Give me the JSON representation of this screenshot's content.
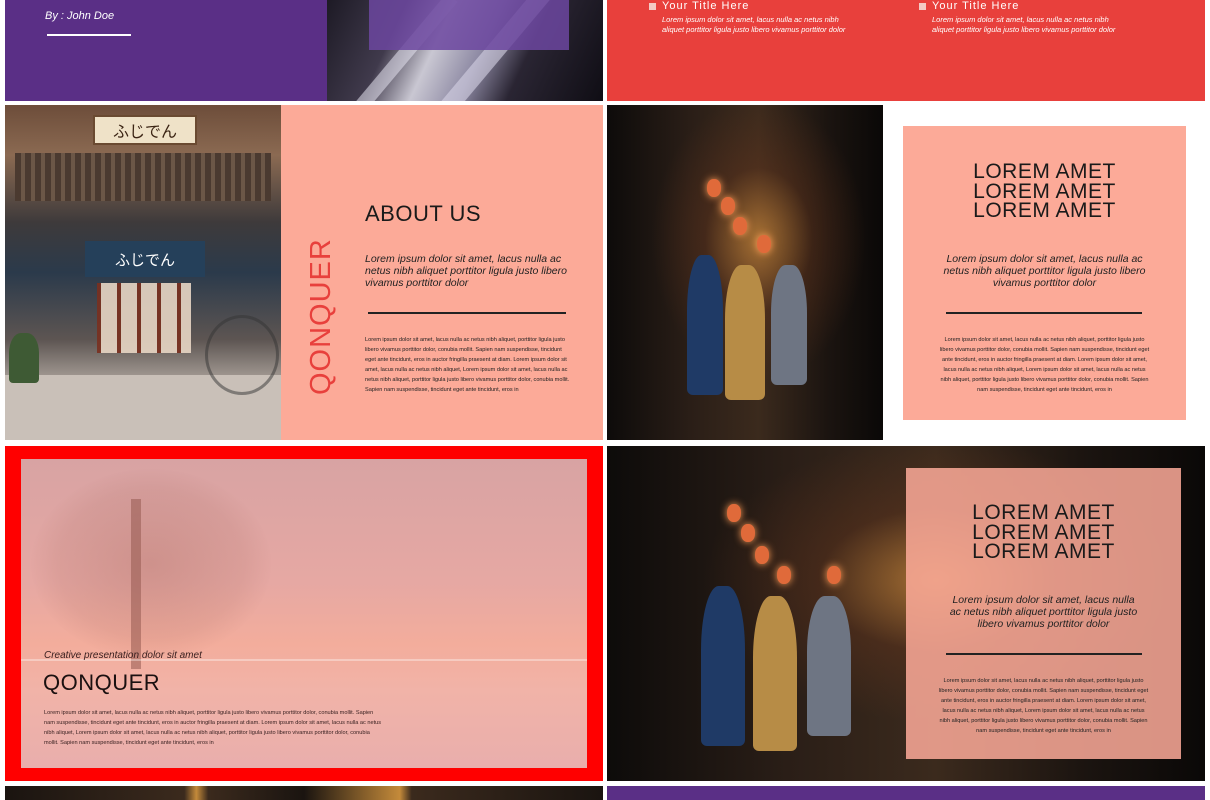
{
  "slides": {
    "top_left": {
      "byline": "By : John Doe"
    },
    "top_right": {
      "columns": [
        {
          "title": "Your Title Here",
          "description": "Lorem ipsum dolor sit amet, lacus nulla ac netus nibh aliquet porttitor ligula justo libero vivamus porttitor dolor"
        },
        {
          "title": "Your Title Here",
          "description": "Lorem ipsum dolor sit amet, lacus nulla ac netus nibh aliquet porttitor ligula justo libero vivamus porttitor dolor"
        }
      ]
    },
    "about": {
      "shop_sign": "ふじでん",
      "shop_curtain": "ふじでん",
      "brand": "QONQUER",
      "heading": "ABOUT US",
      "intro": "Lorem ipsum dolor sit amet, lacus nulla ac netus nibh aliquet porttitor ligula justo libero vivamus porttitor dolor",
      "body": "Lorem ipsum dolor sit amet, lacus nulla ac netus nibh aliquet, porttitor ligula justo libero vivamus porttitor dolor, conubia mollit. Sapien nam suspendisse, tincidunt eget ante tincidunt, eros in auctor fringilla praesent at diam. Lorem ipsum dolor sit amet, lacus nulla ac netus nibh aliquet, Lorem ipsum dolor sit amet, lacus nulla ac netus nibh aliquet, porttitor ligula justo libero vivamus porttitor dolor, conubia mollit. Sapien nam suspendisse, tincidunt eget ante tincidunt, eros in"
    },
    "lorem_card_1": {
      "lines": [
        "LOREM AMET",
        "LOREM AMET",
        "LOREM AMET"
      ],
      "lead": "Lorem ipsum dolor sit amet, lacus nulla ac netus nibh aliquet porttitor ligula justo libero vivamus porttitor dolor",
      "body": "Lorem ipsum dolor sit amet, lacus nulla ac netus nibh aliquet, porttitor ligula justo libero vivamus porttitor dolor, conubia mollit. Sapien nam suspendisse, tincidunt eget ante tincidunt, eros in auctor fringilla praesent at diam. Lorem ipsum dolor sit amet, lacus nulla ac netus nibh aliquet, Lorem ipsum dolor sit amet, lacus nulla ac netus nibh aliquet, porttitor ligula justo libero vivamus porttitor dolor, conubia mollit. Sapien nam suspendisse, tincidunt eget ante tincidunt, eros in"
    },
    "qonquer": {
      "kicker": "Creative presentation dolor sit amet",
      "heading": "QONQUER",
      "body": "Lorem ipsum dolor sit amet, lacus nulla ac netus nibh aliquet, porttitor ligula justo libero vivamus porttitor dolor, conubia mollit. Sapien nam suspendisse, tincidunt eget ante tincidunt, eros in auctor fringilla praesent at diam. Lorem ipsum dolor sit amet, lacus nulla ac netus nibh aliquet, Lorem ipsum dolor sit amet, lacus nulla ac netus nibh aliquet, porttitor ligula justo libero vivamus porttitor dolor, conubia mollit. Sapien nam suspendisse, tincidunt eget ante tincidunt, eros in"
    },
    "lorem_card_2": {
      "lines": [
        "LOREM AMET",
        "LOREM AMET",
        "LOREM AMET"
      ],
      "lead": "Lorem ipsum dolor sit amet, lacus nulla ac netus nibh aliquet porttitor ligula justo libero vivamus porttitor dolor",
      "body": "Lorem ipsum dolor sit amet, lacus nulla ac netus nibh aliquet, porttitor ligula justo libero vivamus porttitor dolor, conubia mollit. Sapien nam suspendisse, tincidunt eget ante tincidunt, eros in auctor fringilla praesent at diam. Lorem ipsum dolor sit amet, lacus nulla ac netus nibh aliquet, Lorem ipsum dolor sit amet, lacus nulla ac netus nibh aliquet, porttitor ligula justo libero vivamus porttitor dolor, conubia mollit. Sapien nam suspendisse, tincidunt eget ante tincidunt, eros in"
    }
  },
  "colors": {
    "purple": "#5a2f86",
    "red": "#e8403c",
    "salmon": "#fcaa98",
    "frame_red": "#ff0000",
    "text_dark": "#1a1a1a"
  }
}
